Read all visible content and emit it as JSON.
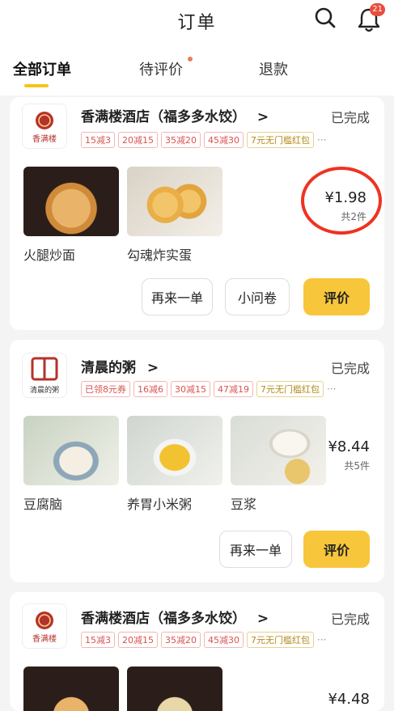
{
  "header": {
    "title": "订单",
    "notification_count": "21"
  },
  "tabs": [
    {
      "label": "全部订单"
    },
    {
      "label": "待评价"
    },
    {
      "label": "退款"
    }
  ],
  "orders": [
    {
      "store": "香满楼酒店（福多多水饺）",
      "chevron": ">",
      "status": "已完成",
      "logo_text": "香满楼",
      "coupons": [
        "15减3",
        "20减15",
        "35减20",
        "45减30",
        "7元无门槛红包"
      ],
      "items": [
        {
          "name": "火腿炒面"
        },
        {
          "name": "勾魂炸实蛋"
        }
      ],
      "price": "¥1.98",
      "count": "共2件",
      "buttons": [
        "再来一单",
        "小问卷",
        "评价"
      ]
    },
    {
      "store": "清晨的粥",
      "chevron": ">",
      "status": "已完成",
      "logo_text": "清晨的粥",
      "coupons": [
        "已领8元券",
        "16减6",
        "30减15",
        "47减19",
        "7元无门槛红包"
      ],
      "items": [
        {
          "name": "豆腐脑"
        },
        {
          "name": "养胃小米粥"
        },
        {
          "name": "豆浆"
        }
      ],
      "price": "¥8.44",
      "count": "共5件",
      "buttons": [
        "再来一单",
        "评价"
      ]
    },
    {
      "store": "香满楼酒店（福多多水饺）",
      "chevron": ">",
      "status": "已完成",
      "logo_text": "香满楼",
      "coupons": [
        "15减3",
        "20减15",
        "35减20",
        "45减30",
        "7元无门槛红包"
      ],
      "price": "¥4.48"
    }
  ],
  "icons": {
    "search": "search-icon",
    "bell": "bell-icon",
    "more": "more-icon"
  },
  "colors": {
    "accent": "#f8c63b",
    "badge": "#e74c3c",
    "annotation": "#e32222"
  }
}
